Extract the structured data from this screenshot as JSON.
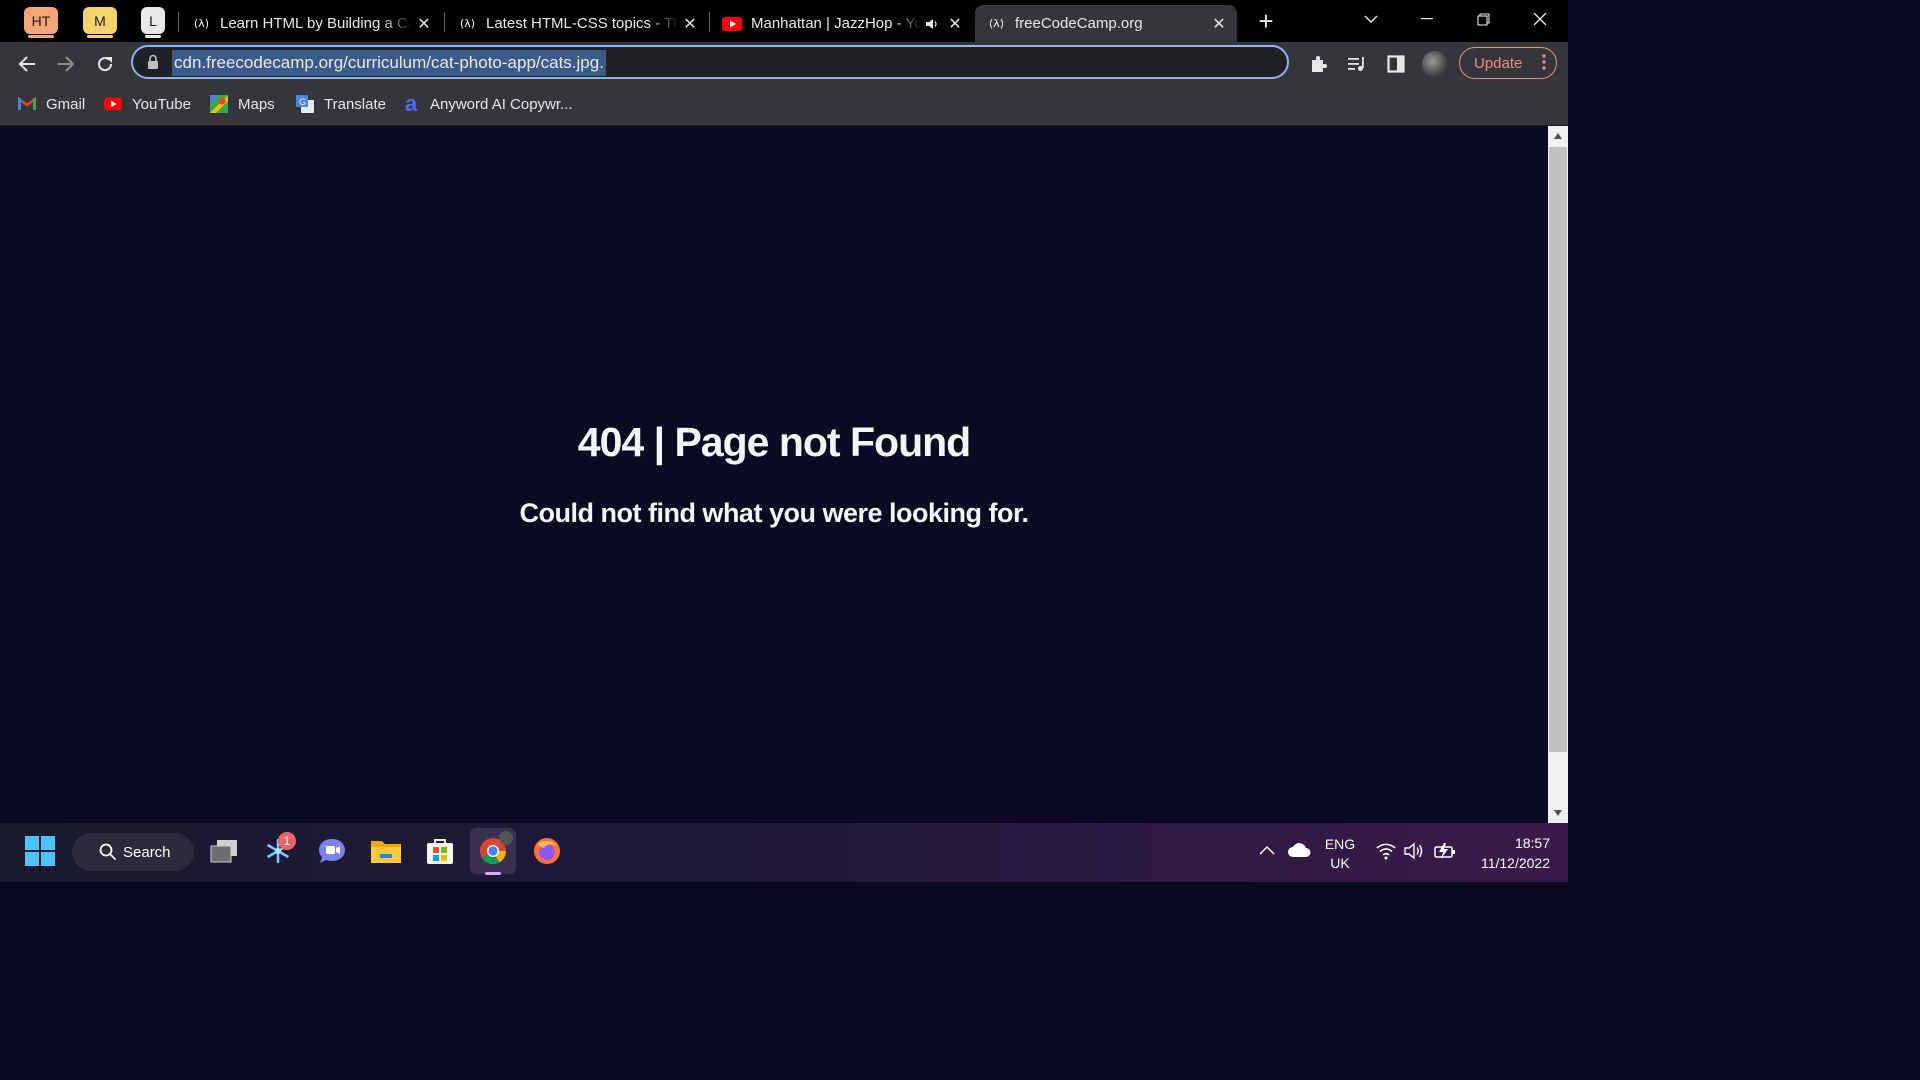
{
  "browser": {
    "pinned_tabs": [
      {
        "label": "HT",
        "color": "#f4a574"
      },
      {
        "label": "M",
        "color": "#f6d36b"
      },
      {
        "label": "L",
        "color": "#e8e8e8"
      }
    ],
    "tabs": [
      {
        "title": "Learn HTML by Building a Cat Photo App",
        "favicon": "freecodecamp-icon",
        "active": false
      },
      {
        "title": "Latest HTML-CSS topics - The freeCodeCamp Forum",
        "favicon": "freecodecamp-icon",
        "active": false
      },
      {
        "title": "Manhattan | JazzHop - YouTube",
        "favicon": "youtube-icon",
        "active": false,
        "audio": true
      },
      {
        "title": "freeCodeCamp.org",
        "favicon": "freecodecamp-icon",
        "active": true
      }
    ],
    "address_bar": {
      "url": "cdn.freecodecamp.org/curriculum/cat-photo-app/cats.jpg."
    },
    "update_button": "Update",
    "bookmarks": [
      {
        "label": "Gmail",
        "icon": "gmail-icon"
      },
      {
        "label": "YouTube",
        "icon": "youtube-icon"
      },
      {
        "label": "Maps",
        "icon": "maps-icon"
      },
      {
        "label": "Translate",
        "icon": "translate-icon"
      },
      {
        "label": "Anyword AI Copywr...",
        "icon": "anyword-icon"
      }
    ],
    "accent_color": "#8ab4f8"
  },
  "page": {
    "title": "404 | Page not Found",
    "message": "Could not find what you were looking for.",
    "background": "#0a0a23"
  },
  "taskbar": {
    "search_label": "Search",
    "notification_badge": "1",
    "language": "ENG",
    "region": "UK",
    "time": "18:57",
    "date": "11/12/2022"
  }
}
